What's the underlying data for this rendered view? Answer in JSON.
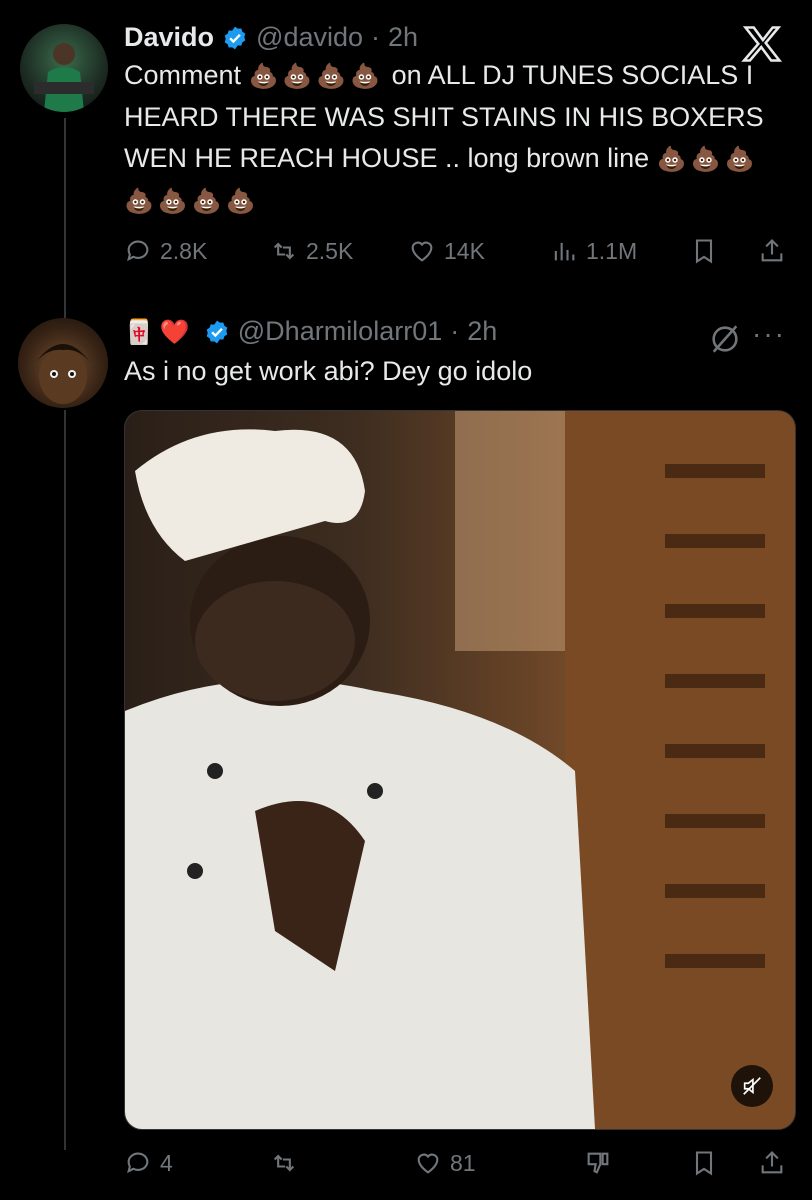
{
  "tweet1": {
    "name": "Davido",
    "handle": "@davido",
    "time": "2h",
    "text_part1": "Comment",
    "emojis_a": "💩💩💩💩",
    "text_part2": "on ALL DJ TUNES SOCIALS I HEARD THERE WAS SHIT STAINS IN HIS BOXERS WEN HE REACH HOUSE .. long brown line",
    "emojis_b": "💩💩💩💩💩💩💩",
    "stats": {
      "replies": "2.8K",
      "reposts": "2.5K",
      "likes": "14K",
      "views": "1.1M"
    }
  },
  "tweet2": {
    "name_emojis": "🀄❤️",
    "handle": "@Dharmilolarr01",
    "time": "2h",
    "text": "As i no get work abi?  Dey go idolo",
    "stats": {
      "replies": "4",
      "likes": "81"
    }
  },
  "colors": {
    "background": "#000000",
    "text": "#e7e9ea",
    "muted": "#71767b",
    "verified": "#1d9bf0"
  },
  "icons": [
    "x-logo-icon",
    "verified-icon",
    "reply-icon",
    "repost-icon",
    "like-icon",
    "views-icon",
    "bookmark-icon",
    "share-icon",
    "grok-icon",
    "more-icon",
    "mute-icon",
    "dislike-icon"
  ]
}
